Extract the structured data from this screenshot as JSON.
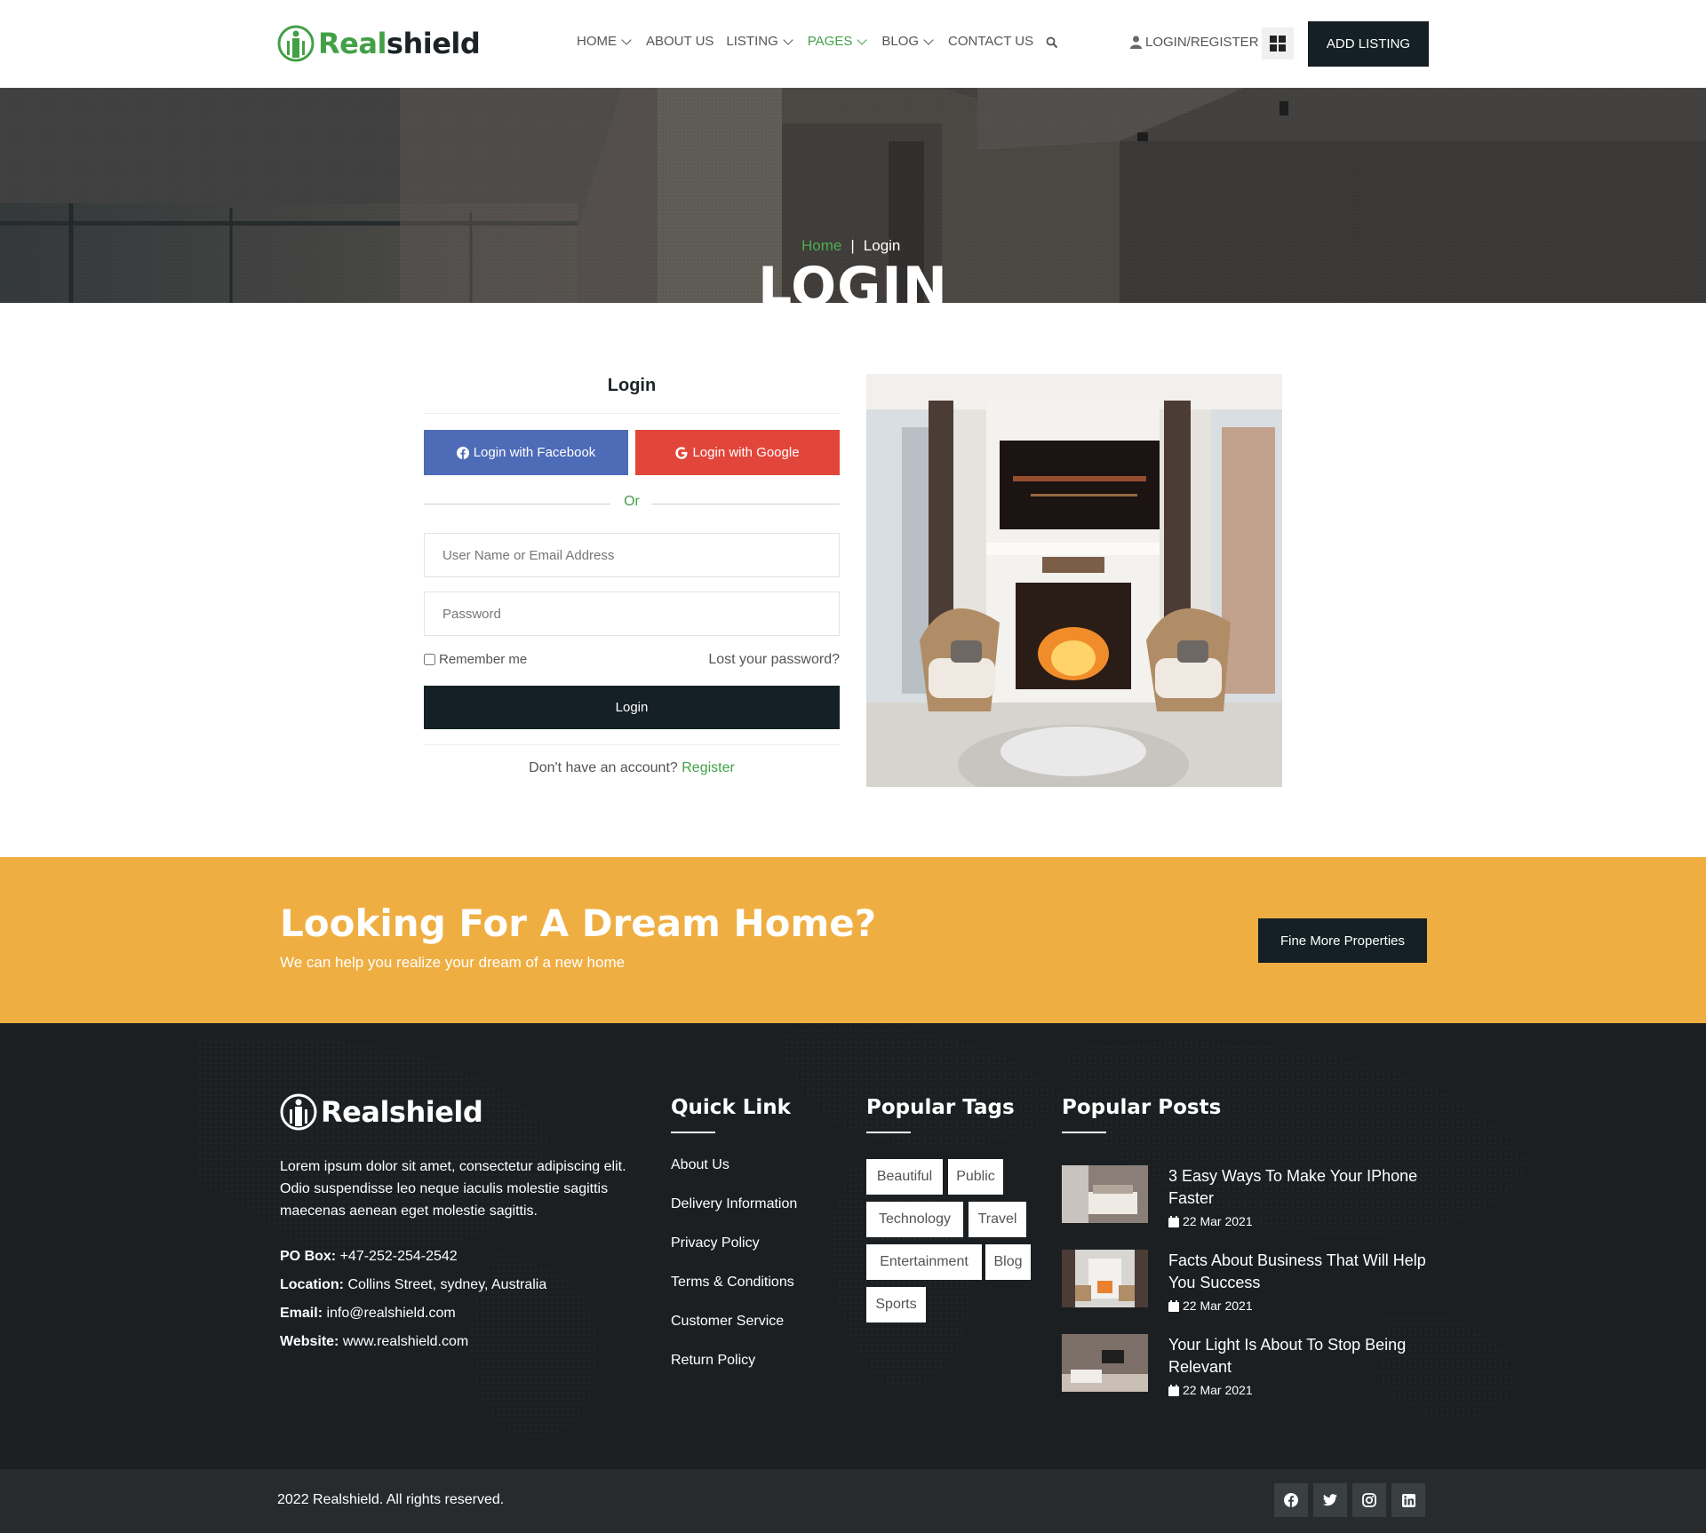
{
  "brand": {
    "name_part1": "Real",
    "name_part2": "shield",
    "footer_name": "Realshield"
  },
  "nav": {
    "items": [
      {
        "label": "HOME",
        "dropdown": true
      },
      {
        "label": "ABOUT US",
        "dropdown": false
      },
      {
        "label": "LISTING",
        "dropdown": true
      },
      {
        "label": "PAGES",
        "dropdown": true,
        "active": true
      },
      {
        "label": "BLOG",
        "dropdown": true
      },
      {
        "label": "CONTACT US",
        "dropdown": false
      }
    ],
    "search_icon": "search-icon",
    "login_register": "LOGIN/REGISTER",
    "grid_icon": "grid-icon",
    "add_listing": "ADD LISTING"
  },
  "hero": {
    "breadcrumb_home": "Home",
    "breadcrumb_sep": "|",
    "breadcrumb_current": "Login",
    "title": "LOGIN"
  },
  "login": {
    "heading": "Login",
    "facebook_label": "Login with Facebook",
    "google_label": "Login with Google",
    "or_label": "Or",
    "username_placeholder": "User Name or Email Address",
    "password_placeholder": "Password",
    "remember_label": "Remember me",
    "lost_password": "Lost your password?",
    "submit_label": "Login",
    "no_account_text": "Don't have an account?",
    "register_link": "Register"
  },
  "cta": {
    "title": "Looking For A Dream Home?",
    "subtitle": "We can help you realize your dream of a new home",
    "button": "Fine More Properties"
  },
  "footer": {
    "about": "Lorem ipsum dolor sit amet, consectetur adipiscing elit. Odio suspendisse leo neque iaculis molestie sagittis maecenas aenean eget molestie sagittis.",
    "contact": [
      {
        "label": "PO Box:",
        "value": "+47-252-254-2542"
      },
      {
        "label": "Location:",
        "value": "Collins Street, sydney, Australia"
      },
      {
        "label": "Email:",
        "value": "info@realshield.com"
      },
      {
        "label": "Website:",
        "value": "www.realshield.com"
      }
    ],
    "quick_link_title": "Quick Link",
    "quick_links": [
      "About Us",
      "Delivery Information",
      "Privacy Policy",
      "Terms & Conditions",
      "Customer Service",
      "Return Policy"
    ],
    "tags_title": "Popular Tags",
    "tags": [
      "Beautiful",
      "Public",
      "Technology",
      "Travel",
      "Entertainment",
      "Blog",
      "Sports"
    ],
    "posts_title": "Popular Posts",
    "posts": [
      {
        "title": "3 Easy Ways To Make Your IPhone Faster",
        "date": "22 Mar 2021"
      },
      {
        "title": "Facts About Business That Will Help You Success",
        "date": "22 Mar 2021"
      },
      {
        "title": "Your Light Is About To Stop Being Relevant",
        "date": "22 Mar 2021"
      }
    ],
    "copyright": "2022 Realshield. All rights reserved.",
    "social": [
      "facebook-icon",
      "twitter-icon",
      "instagram-icon",
      "linkedin-icon"
    ]
  },
  "colors": {
    "accent": "#43a047",
    "dark": "#142025",
    "facebook": "#4e6bb8",
    "google": "#e2463a",
    "cta": "#efae42",
    "footer": "#1b1f21"
  }
}
